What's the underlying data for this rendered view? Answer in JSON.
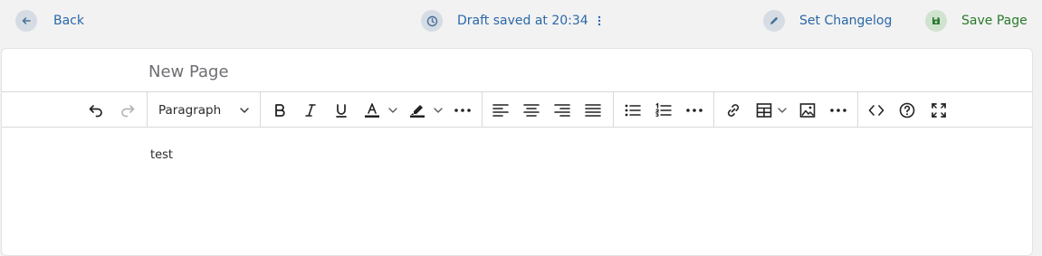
{
  "topbar": {
    "back_label": "Back",
    "draft_status": "Draft saved at 20:34",
    "changelog_label": "Set Changelog",
    "save_label": "Save Page"
  },
  "editor": {
    "title_placeholder": "New Page",
    "block_format": "Paragraph",
    "content_text": "test"
  },
  "colors": {
    "link_blue": "#2a68a8",
    "save_green": "#2a7a2a",
    "text_color_underline": "#1a1a1a",
    "highlight_underline": "#1a1a1a"
  },
  "icons": {
    "back": "arrow-left-icon",
    "draft": "clock-icon",
    "menu": "kebab-icon",
    "changelog": "pencil-icon",
    "save": "floppy-disk-icon"
  }
}
